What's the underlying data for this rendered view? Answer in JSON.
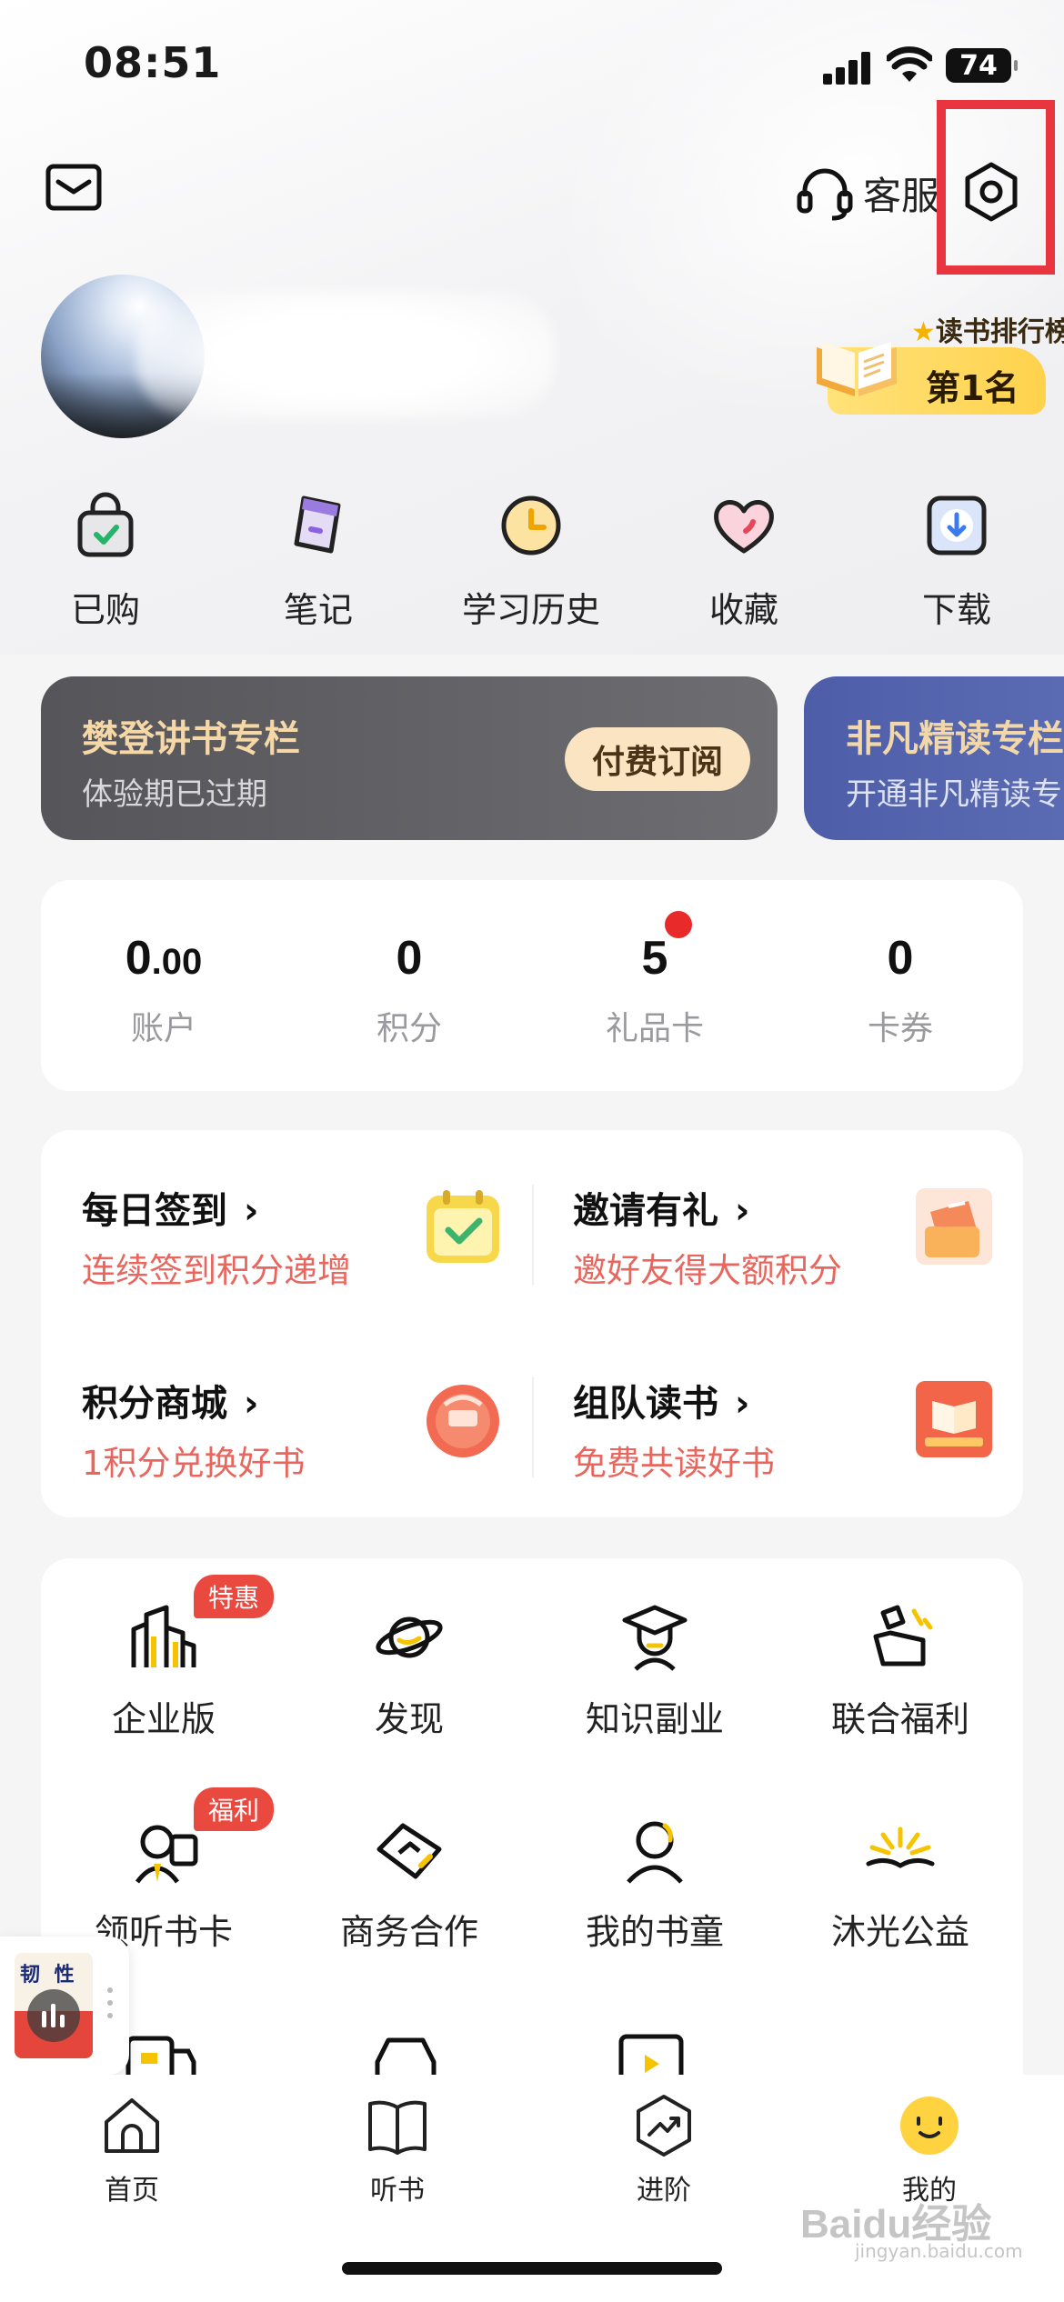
{
  "status_bar": {
    "time": "08:51",
    "battery": "74"
  },
  "top_bar": {
    "customer_service": "客服"
  },
  "rank": {
    "title": "读书排行榜",
    "place": "第1名"
  },
  "quick_actions": [
    {
      "label": "已购",
      "icon": "shopping-bag-icon"
    },
    {
      "label": "笔记",
      "icon": "notes-icon"
    },
    {
      "label": "学习历史",
      "icon": "clock-icon"
    },
    {
      "label": "收藏",
      "icon": "heart-icon"
    },
    {
      "label": "下载",
      "icon": "download-icon"
    }
  ],
  "columns": [
    {
      "title": "樊登讲书专栏",
      "subtitle": "体验期已过期",
      "button": "付费订阅"
    },
    {
      "title": "非凡精读专栏",
      "subtitle": "开通非凡精读专"
    }
  ],
  "stats": [
    {
      "value_main": "0",
      "value_dec": ".00",
      "label": "账户"
    },
    {
      "value_main": "0",
      "value_dec": "",
      "label": "积分"
    },
    {
      "value_main": "5",
      "value_dec": "",
      "label": "礼品卡"
    },
    {
      "value_main": "0",
      "value_dec": "",
      "label": "卡券"
    }
  ],
  "tasks": [
    {
      "title": "每日签到",
      "subtitle": "连续签到积分递增"
    },
    {
      "title": "邀请有礼",
      "subtitle": "邀好友得大额积分"
    },
    {
      "title": "积分商城",
      "subtitle": "1积分兑换好书"
    },
    {
      "title": "组队读书",
      "subtitle": "免费共读好书"
    }
  ],
  "services": [
    {
      "label": "企业版",
      "badge": "特惠"
    },
    {
      "label": "发现",
      "badge": ""
    },
    {
      "label": "知识副业",
      "badge": ""
    },
    {
      "label": "联合福利",
      "badge": ""
    },
    {
      "label": "领听书卡",
      "badge": "福利"
    },
    {
      "label": "商务合作",
      "badge": ""
    },
    {
      "label": "我的书童",
      "badge": ""
    },
    {
      "label": "沐光公益",
      "badge": ""
    }
  ],
  "mini_player": {
    "cover_title": "韧 性"
  },
  "tabs": [
    {
      "label": "首页"
    },
    {
      "label": "听书"
    },
    {
      "label": "进阶"
    },
    {
      "label": "我的"
    }
  ],
  "watermark": {
    "main": "Baidu经验",
    "sub": "jingyan.baidu.com"
  },
  "colors": {
    "accent_red": "#e8353f",
    "task_red": "#e8665e",
    "tab_active": "#ffd23f"
  }
}
